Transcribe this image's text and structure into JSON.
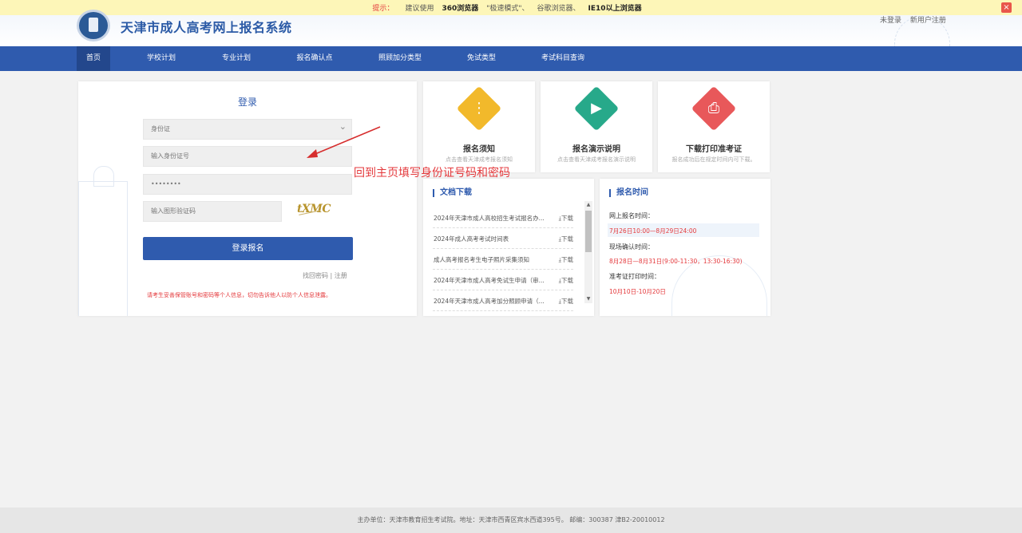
{
  "tipbar": {
    "label": "提示：",
    "prefix": "建议使用",
    "browser1": "360浏览器",
    "mode": "\"极速模式\"、",
    "browser2": "谷歌浏览器、",
    "browser3": "IE10以上浏览器",
    "close_icon": "×"
  },
  "header": {
    "title": "天津市成人高考网上报名系统",
    "not_logged_in": "未登录",
    "register_link": "新用户注册"
  },
  "nav": {
    "items": [
      {
        "label": "首页"
      },
      {
        "label": "学校计划"
      },
      {
        "label": "专业计划"
      },
      {
        "label": "报名确认点"
      },
      {
        "label": "照顾加分类型"
      },
      {
        "label": "免试类型"
      },
      {
        "label": "考试科目查询"
      }
    ]
  },
  "login": {
    "title": "登录",
    "id_type_value": "身份证",
    "id_number_placeholder": "输入身份证号",
    "password_value": "••••••••",
    "captcha_placeholder": "输入图形验证码",
    "captcha_text": "tXMC",
    "submit_label": "登录报名",
    "forgot_label": "找回密码",
    "separator": "|",
    "register_label": "注册",
    "notice": "请考生妥善保管账号和密码等个人信息，切勿告诉他人以防个人信息泄露。"
  },
  "cards": [
    {
      "title": "报名须知",
      "desc": "点击查看天津成考报名须知",
      "icon": "notice-icon",
      "glyph": "⋮",
      "color": "#f2b92b"
    },
    {
      "title": "报名演示说明",
      "desc": "点击查看天津成考报名演示说明",
      "icon": "video-icon",
      "glyph": "▶",
      "color": "#27a98a"
    },
    {
      "title": "下载打印准考证",
      "desc": "报名成功后在规定时间内可下载。",
      "icon": "printer-icon",
      "glyph": "⎙",
      "color": "#e8585a"
    }
  ],
  "annotation": {
    "text": "回到主页填写身份证号码和密码"
  },
  "docs": {
    "title": "文档下载",
    "download_label": "下载",
    "items": [
      {
        "name": "2024年天津市成人高校招生考试报名办..."
      },
      {
        "name": "2024年成人高考考试时间表"
      },
      {
        "name": "成人高考报名考生电子照片采集须知"
      },
      {
        "name": "2024年天津市成人高考免试生申请（审..."
      },
      {
        "name": "2024年天津市成人高考加分照顾申请（..."
      }
    ]
  },
  "regtime": {
    "title": "报名时间",
    "online_label": "网上报名时间：",
    "online_value": "7月26日10:00—8月29日24:00",
    "onsite_label": "现场确认时间：",
    "onsite_value": "8月28日—8月31日(9:00-11:30，13:30-16:30)",
    "ticket_label": "准考证打印时间：",
    "ticket_value": "10月10日-10月20日"
  },
  "footer": {
    "text": "主办单位：天津市教育招生考试院。地址：天津市西青区宾水西道395号。 邮编：300387 津B2-20010012"
  },
  "colors": {
    "brand": "#2f5bae",
    "alert": "#e4393c",
    "tipbar": "#fdf6b8"
  }
}
